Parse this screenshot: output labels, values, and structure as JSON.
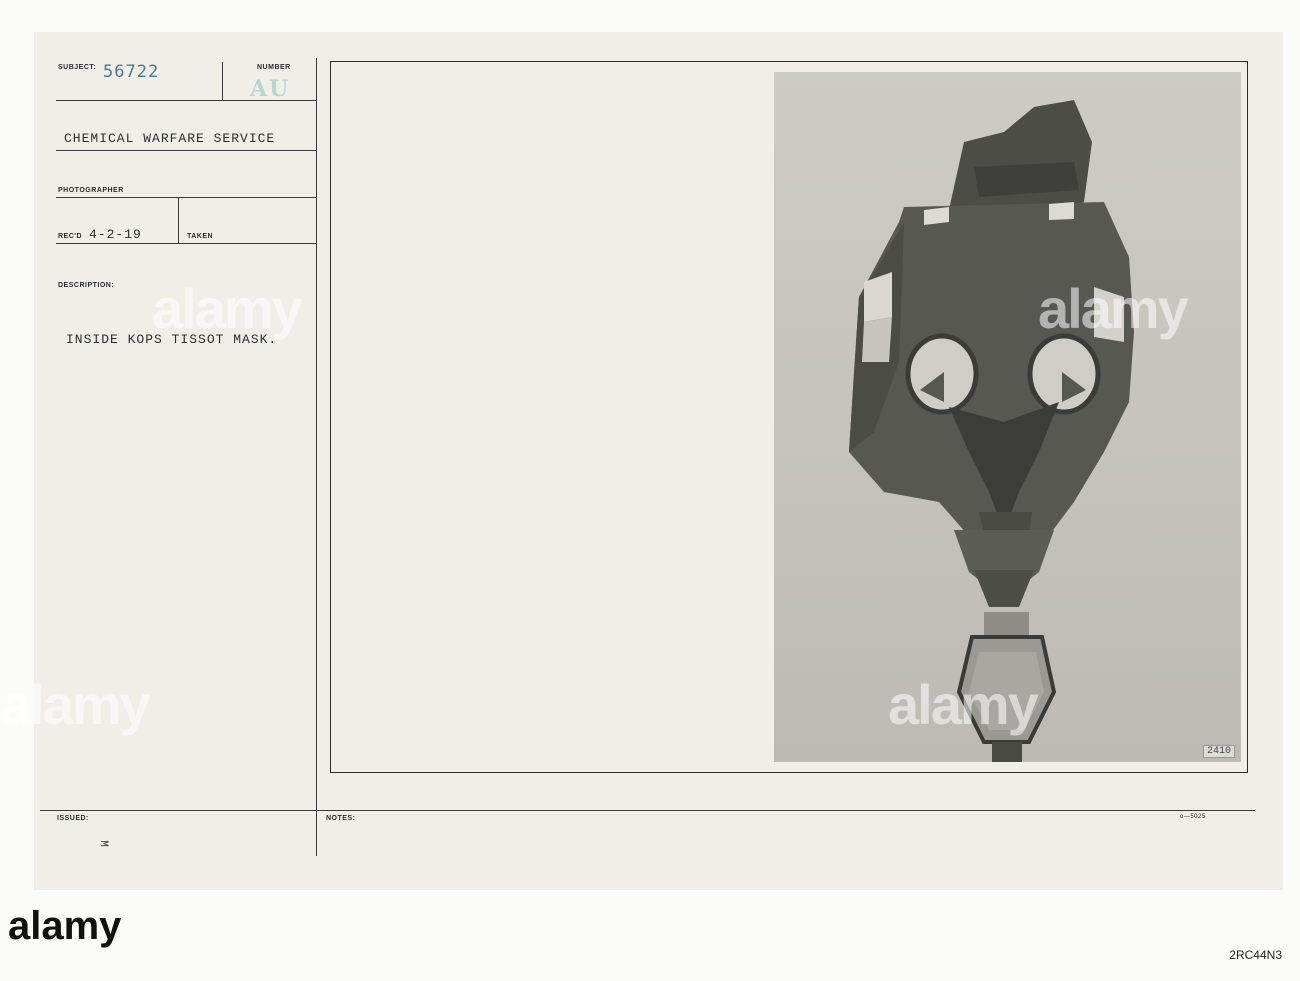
{
  "card": {
    "subject_label": "SUBJECT:",
    "subject_number": "56722",
    "number_label": "NUMBER",
    "number_value": "AU",
    "service": "CHEMICAL WARFARE SERVICE",
    "photographer_label": "PHOTOGRAPHER",
    "recd_label": "REC'D",
    "recd_value": "4-2-19",
    "taken_label": "TAKEN",
    "description_label": "DESCRIPTION:",
    "description_value": "INSIDE KOPS TISSOT MASK.",
    "issued_label": "ISSUED:",
    "notes_label": "NOTES:",
    "issued_mark": "M",
    "form_code": "o—5025"
  },
  "photo": {
    "negative_number": "2410",
    "subject_icon": "gas-mask-photo"
  },
  "watermark": {
    "brand": "alamy",
    "image_id": "2RC44N3"
  },
  "colors": {
    "card_bg": "#f1eee8",
    "stamp_blue": "#4a7a90",
    "stamp_green": "#b8d6cf"
  }
}
